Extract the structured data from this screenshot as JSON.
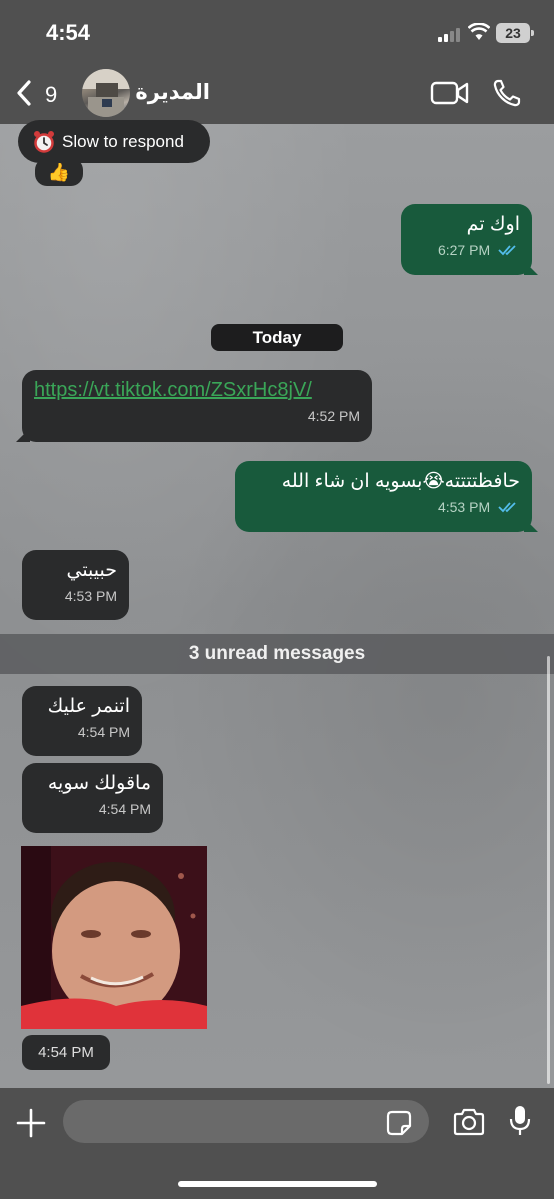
{
  "status_bar": {
    "time": "4:54",
    "battery": "23"
  },
  "header": {
    "back_count": "9",
    "contact_name": "المديرة"
  },
  "banner": {
    "slow_to_respond": "Slow to respond",
    "reaction": "👍"
  },
  "date_separator": "Today",
  "messages": [
    {
      "direction": "out",
      "text": "اوك تم",
      "time": "6:27 PM",
      "read": true
    },
    {
      "direction": "in",
      "text": "https://vt.tiktok.com/ZSxrHc8jV/",
      "time": "4:52 PM"
    },
    {
      "direction": "out",
      "text": "حافظتتتته😭بسويه ان شاء الله",
      "time": "4:53 PM",
      "read": true
    },
    {
      "direction": "in",
      "text": "حبيبتي",
      "time": "4:53 PM"
    },
    {
      "direction": "in",
      "text": "اتنمر عليك",
      "time": "4:54 PM"
    },
    {
      "direction": "in",
      "text": "ماقولك سويه",
      "time": "4:54 PM"
    },
    {
      "direction": "in",
      "type": "photo",
      "time": "4:54 PM"
    }
  ],
  "unread_banner": "3 unread messages",
  "input": {
    "placeholder": ""
  },
  "colors": {
    "incoming_bubble": "#2a2b2c",
    "outgoing_bubble": "#185a3c",
    "link": "#3aa658",
    "read_ticks": "#53bdeb"
  }
}
